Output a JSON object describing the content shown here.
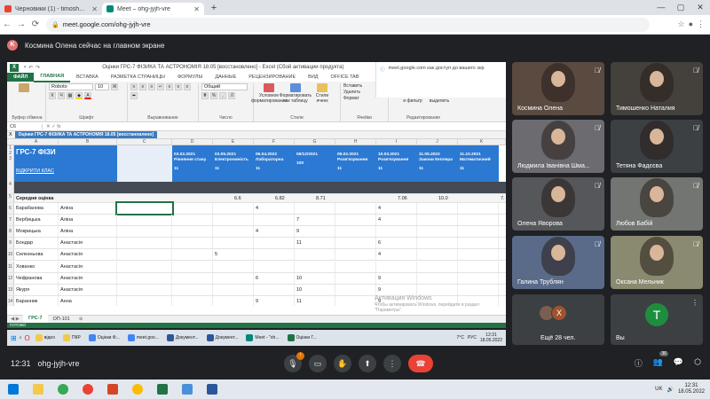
{
  "browser": {
    "tabs": [
      {
        "title": "Черновики (1) - timoshenko.nat",
        "color": "#ea4335",
        "active": false
      },
      {
        "title": "Meet – ohg-jyjh-vre",
        "color": "#00897b",
        "active": true
      }
    ],
    "new_tab": "+",
    "url": "meet.google.com/ohg-jyjh-vre"
  },
  "presenting": {
    "avatar_letter": "K",
    "text": "Космина Олена сейчас на главном экране"
  },
  "excel": {
    "window_title": "Оцінки ГРС-7 ФІЗИКА ТА АСТРОНОМІЯ 18.05 [восстановлено] - Excel (Сбой активации продукта)",
    "ribbon_tabs": [
      "ФАЙЛ",
      "ГЛАВНАЯ",
      "ВСТАВКА",
      "РАЗМЕТКА СТРАНИЦЫ",
      "ФОРМУЛЫ",
      "ДАННЫЕ",
      "РЕЦЕНЗИРОВАНИЕ",
      "ВИД",
      "OFFICE TAB"
    ],
    "font_name": "Roboto",
    "font_size": "10",
    "number_format": "Общий",
    "groups": {
      "clipboard": "Буфер обмена",
      "font": "Шрифт",
      "alignment": "Выравнивание",
      "number": "Число",
      "styles": "Стили",
      "cells": "Ячейки",
      "editing": "Редактирование"
    },
    "ribbon_buttons": {
      "paste": "Вставить",
      "conditional": "Условное форматирование",
      "as_table": "Форматировать как таблицу",
      "cell_styles": "Стили ячеек",
      "insert": "Вставить",
      "delete": "Удалить",
      "format": "Формат",
      "sort": "Сортировка и фильтр",
      "find": "Найти и выделить"
    },
    "name_box": "C6",
    "notice_title": "Оцінки ГРС-7 ФІЗИКА ТА АСТРОНОМІЯ 18.05 [восстановлено]",
    "meet_popup": "meet.google.com как доступ до вашего экр",
    "columns": [
      "A",
      "B",
      "C",
      "D",
      "E",
      "F",
      "G",
      "H",
      "I",
      "J",
      "K"
    ],
    "header_title": "ГРС-7 ФІЗИ",
    "open_class": "ВІДКРИТИ КЛАС",
    "assignments": [
      {
        "date": "03.02.2021",
        "name": "Рівняння стану",
        "max": "11"
      },
      {
        "date": "03.05.2021",
        "name": "Електроємність",
        "max": "11"
      },
      {
        "date": "06.04.2022",
        "name": "Лабораторна",
        "max": "11"
      },
      {
        "date": "06/12/2021",
        "name": "",
        "max": "100"
      },
      {
        "date": "09.02.2021",
        "name": "Розв'язування",
        "max": "11"
      },
      {
        "date": "10.03.2021",
        "name": "Розв'язування",
        "max": "11"
      },
      {
        "date": "11.05.2022",
        "name": "Закони Кеплера",
        "max": "11"
      },
      {
        "date": "11.10.2021",
        "name": "Математичний",
        "max": "11"
      }
    ],
    "average_label": "Середня оцінка",
    "averages": [
      "",
      "6.6",
      "6.82",
      "8.71",
      "",
      "7.06",
      "10.0",
      "",
      "7."
    ],
    "students": [
      {
        "row": "6",
        "last": "Барабанова",
        "first": "Аліна",
        "grades": [
          "",
          "",
          "4",
          "",
          "",
          "4",
          "",
          ""
        ]
      },
      {
        "row": "7",
        "last": "Вербицька",
        "first": "Аліна",
        "grades": [
          "",
          "",
          "",
          "7",
          "",
          "4",
          "",
          ""
        ]
      },
      {
        "row": "8",
        "last": "Мокрицька",
        "first": "Аліна",
        "grades": [
          "",
          "",
          "4",
          "9",
          "",
          "",
          "",
          ""
        ]
      },
      {
        "row": "9",
        "last": "Бондар",
        "first": "Анастасія",
        "grades": [
          "",
          "",
          "",
          "11",
          "",
          "6",
          "",
          ""
        ]
      },
      {
        "row": "10",
        "last": "Селезньова",
        "first": "Анастасія",
        "grades": [
          "",
          "5",
          "",
          "",
          "",
          "4",
          "",
          ""
        ]
      },
      {
        "row": "11",
        "last": "Хованко",
        "first": "Анастасія",
        "grades": [
          "",
          "",
          "",
          "",
          "",
          "",
          "",
          ""
        ]
      },
      {
        "row": "12",
        "last": "Чефранова",
        "first": "Анастасія",
        "grades": [
          "",
          "",
          "6",
          "10",
          "",
          "9",
          "",
          ""
        ]
      },
      {
        "row": "13",
        "last": "Якуря",
        "first": "Анастасія",
        "grades": [
          "",
          "",
          "",
          "10",
          "",
          "9",
          "",
          ""
        ]
      },
      {
        "row": "14",
        "last": "Баранник",
        "first": "Анна",
        "grades": [
          "",
          "",
          "9",
          "11",
          "",
          "9",
          "",
          ""
        ]
      }
    ],
    "sheets": [
      "ГРС-7",
      "ОП-101"
    ],
    "status": "ГОТОВО",
    "watermark_title": "Активация Windows",
    "watermark_text": "Чтобы активировать Windows, перейдите в раздел \"Параметры\"."
  },
  "inner_taskbar": {
    "items": [
      {
        "label": "відео",
        "color": "#f2c94c"
      },
      {
        "label": "ПКР",
        "color": "#f2c94c"
      },
      {
        "label": "Оцінки Ф...",
        "color": "#4285f4"
      },
      {
        "label": "meet.goo...",
        "color": "#4285f4"
      },
      {
        "label": "Документ...",
        "color": "#2b579a"
      },
      {
        "label": "Документ...",
        "color": "#2b579a"
      },
      {
        "label": "Meet - \"oh...",
        "color": "#00897b"
      },
      {
        "label": "Оцінки Г...",
        "color": "#217346"
      }
    ],
    "temp": "7°C",
    "lang": "РУС",
    "time": "12:31",
    "date": "18.05.2022"
  },
  "participants": [
    {
      "name": "Космина Олена",
      "bg": "#5a4a40"
    },
    {
      "name": "Тимошенко Наталия",
      "bg": "#44403c"
    },
    {
      "name": "Людмила Іванівна Шма...",
      "bg": "#6b6b70"
    },
    {
      "name": "Тетяна Фадєєва",
      "bg": "#3c4043"
    },
    {
      "name": "Олена Яворова",
      "bg": "#56575b"
    },
    {
      "name": "Любов Бабій",
      "bg": "#727572"
    },
    {
      "name": "Галина Трублян",
      "bg": "#5a6b8a"
    },
    {
      "name": "Оксана Мельник",
      "bg": "#8a8a70"
    }
  ],
  "more_tile": {
    "label": "Ещё 28 чел.",
    "avatar2": "X"
  },
  "self_tile": {
    "label": "Вы",
    "letter": "T"
  },
  "controls": {
    "time": "12:31",
    "code": "ohg-jyjh-vre",
    "mic_badge": "!",
    "people_count": "36"
  },
  "taskbar": {
    "lang": "UK",
    "time": "12:31",
    "date": "18.05.2022"
  }
}
